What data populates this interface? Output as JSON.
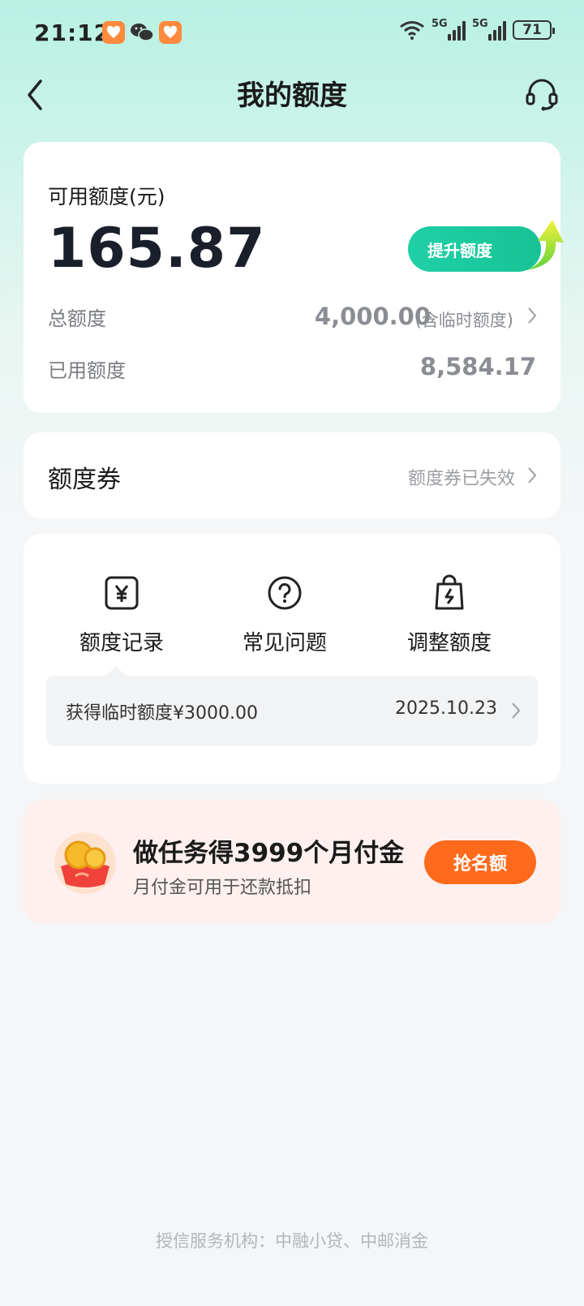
{
  "status_bar": {
    "time": "21:12",
    "battery": "71",
    "network": "5G"
  },
  "nav": {
    "title": "我的额度"
  },
  "quota": {
    "available_label": "可用额度(元)",
    "available_amount": "165.87",
    "boost_button": "提升额度",
    "total_label": "总额度",
    "total_value": "4,000.00",
    "total_note": "(含临时额度)",
    "used_label": "已用额度",
    "used_value": "8,584.17"
  },
  "coupon": {
    "title": "额度券",
    "status": "额度券已失效"
  },
  "shortcuts": [
    {
      "label": "额度记录",
      "icon": "yuan-receipt-icon"
    },
    {
      "label": "常见问题",
      "icon": "question-circle-icon"
    },
    {
      "label": "调整额度",
      "icon": "bag-lightning-icon"
    }
  ],
  "record": {
    "text": "获得临时额度¥3000.00",
    "date": "2025.10.23"
  },
  "promo": {
    "title": "做任务得3999个月付金",
    "subtitle": "月付金可用于还款抵扣",
    "button": "抢名额",
    "icon": "coin-icon"
  },
  "footer": {
    "text": "授信服务机构：中融小贷、中邮消金"
  },
  "colors": {
    "accent_green": "#1fd0a7",
    "promo_orange": "#ff6a1c"
  }
}
